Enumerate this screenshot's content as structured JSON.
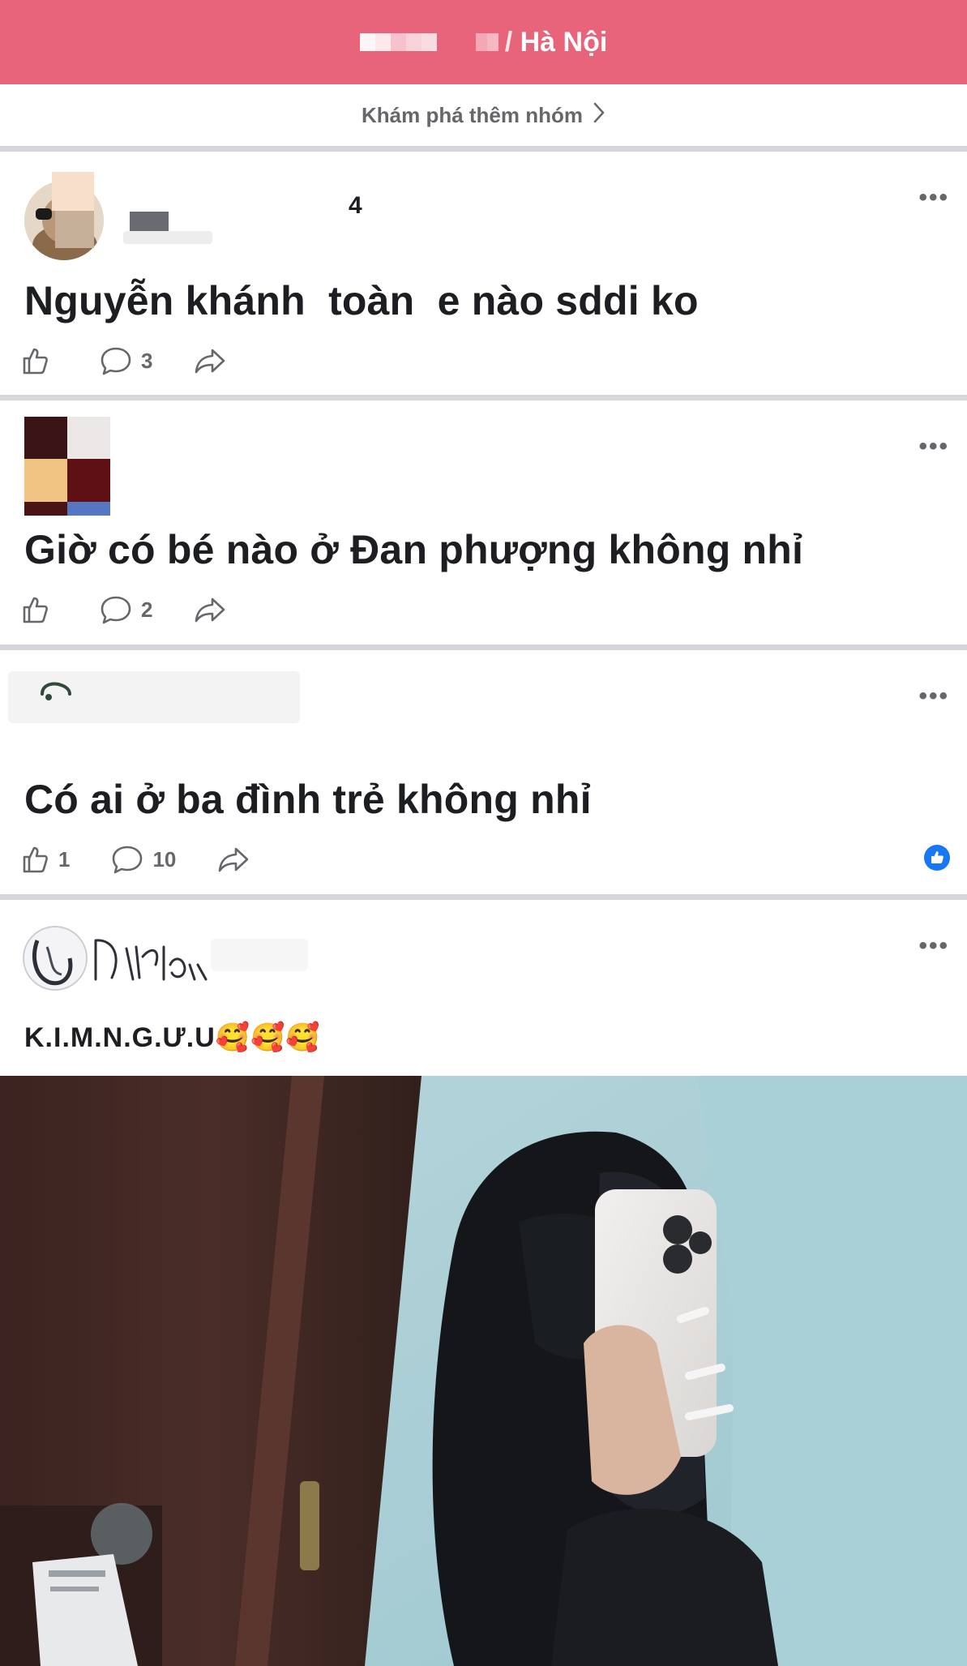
{
  "header": {
    "title": "Hà Nội",
    "background": "#e8647a"
  },
  "explore": {
    "label": "Khám phá thêm nhóm",
    "chevron_icon": "chevron-right-icon"
  },
  "posts": [
    {
      "author_fragment": "4",
      "text": "Nguyễn khánh  toàn  e nào sddi ko",
      "likes": "",
      "comments": "3"
    },
    {
      "text": "Giờ có bé nào ở Đan phượng không nhỉ",
      "likes": "",
      "comments": "2"
    },
    {
      "text": "Có ai ở ba đình trẻ không nhỉ",
      "likes": "1",
      "comments": "10",
      "reaction_icon": "like-reaction-icon"
    },
    {
      "text": "K.I.M.N.G.Ư.U🥰🥰🥰",
      "has_photo": true
    }
  ],
  "colors": {
    "accent": "#e8647a",
    "icon_gray": "#65676b",
    "like_blue": "#1877f2"
  },
  "icons": {
    "more": "more-horizontal-icon",
    "like": "thumbs-up-icon",
    "comment": "comment-bubble-icon",
    "share": "share-arrow-icon"
  }
}
